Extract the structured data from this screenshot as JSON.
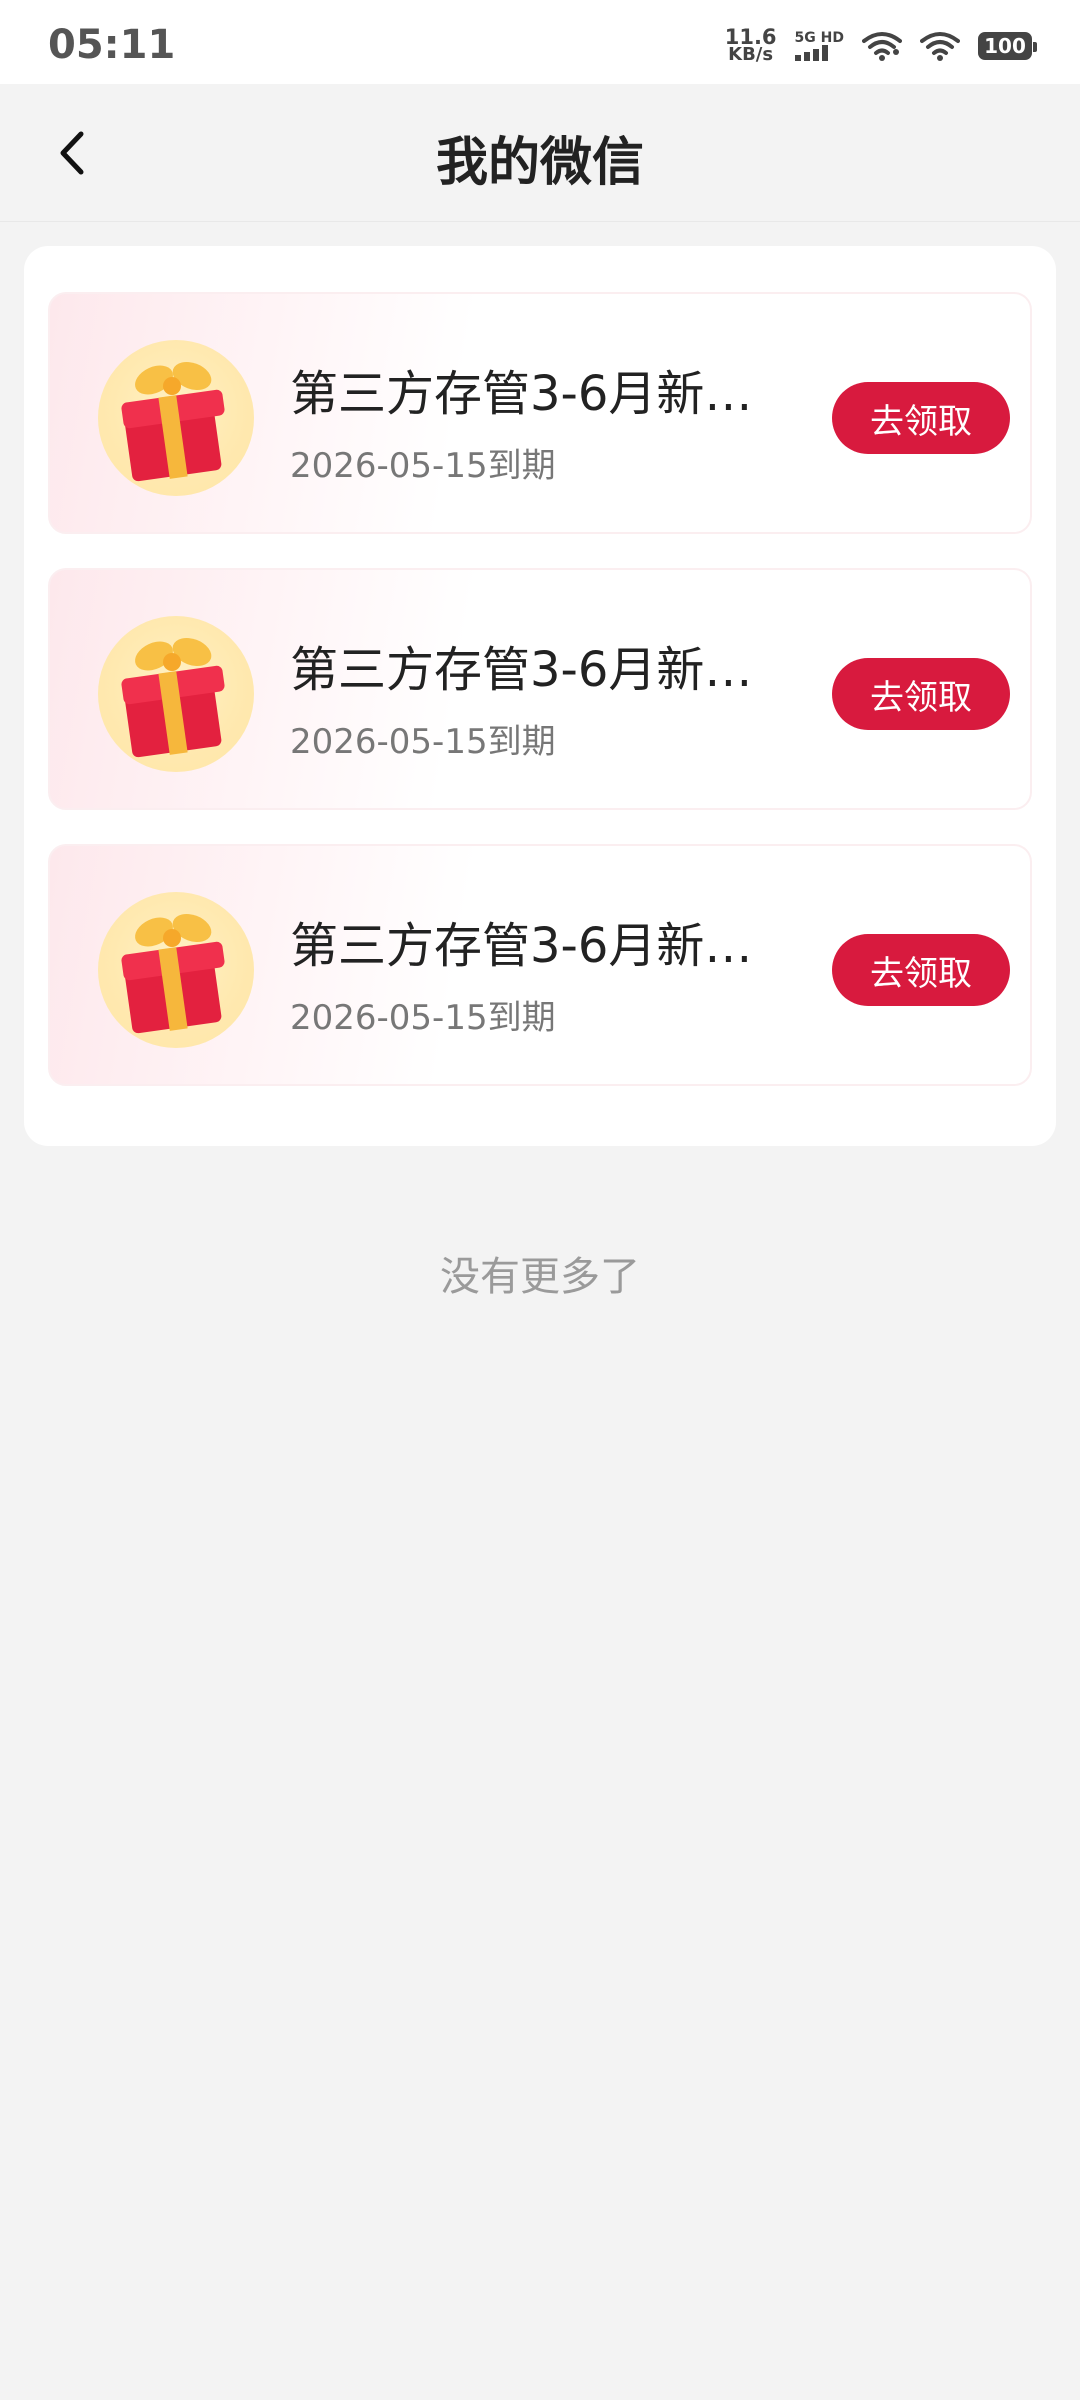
{
  "status_bar": {
    "time": "05:11",
    "net_speed_value": "11.6",
    "net_speed_unit": "KB/s",
    "network_label": "5G HD",
    "battery": "100"
  },
  "header": {
    "title": "我的微信",
    "back_icon": "chevron-left-icon"
  },
  "coupons": [
    {
      "title": "第三方存管3-6月新…",
      "expiry": "2026-05-15到期",
      "button": "去领取",
      "icon": "gift-icon"
    },
    {
      "title": "第三方存管3-6月新…",
      "expiry": "2026-05-15到期",
      "button": "去领取",
      "icon": "gift-icon"
    },
    {
      "title": "第三方存管3-6月新…",
      "expiry": "2026-05-15到期",
      "button": "去领取",
      "icon": "gift-icon"
    }
  ],
  "footer": {
    "no_more": "没有更多了"
  },
  "colors": {
    "accent": "#d81a3e",
    "background": "#f3f3f3",
    "card": "#ffffff"
  }
}
